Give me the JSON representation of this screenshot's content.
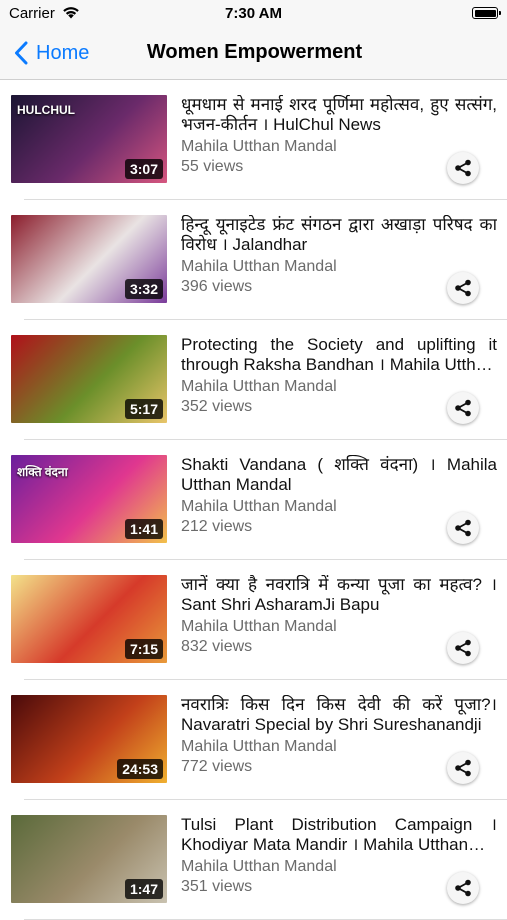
{
  "status_bar": {
    "carrier": "Carrier",
    "time": "7:30 AM"
  },
  "nav": {
    "back_label": "Home",
    "title": "Women Empowerment"
  },
  "videos": [
    {
      "title": "धूमधाम से मनाई शरद पूर्णिमा महोत्सव, हुए सत्संग, भजन-कीर्तन । HulChul News",
      "channel": "Mahila Utthan Mandal",
      "views": "55 views",
      "duration": "3:07",
      "thumb_overlay": "HULCHUL",
      "thumb_colors": [
        "#1b1533",
        "#6a2a6a",
        "#d6567f"
      ]
    },
    {
      "title": "हिन्दू यूनाइटेड फ्रंट संगठन द्वारा अखाड़ा परिषद का विरोध । Jalandhar",
      "channel": "Mahila Utthan Mandal",
      "views": "396 views",
      "duration": "3:32",
      "thumb_overlay": "",
      "thumb_colors": [
        "#8b1d2c",
        "#e9e3e3",
        "#7a3b9a"
      ]
    },
    {
      "title": "Protecting the Society and uplifting it through Raksha Bandhan । Mahila Utthan Mandal",
      "channel": "Mahila Utthan Mandal",
      "views": "352 views",
      "duration": "5:17",
      "thumb_overlay": "",
      "thumb_colors": [
        "#b0101a",
        "#6b8f2a",
        "#e9c56a"
      ]
    },
    {
      "title": "Shakti Vandana ( शक्ति वंदना) । Mahila Utthan Mandal",
      "channel": "Mahila Utthan Mandal",
      "views": "212 views",
      "duration": "1:41",
      "thumb_overlay": "शक्ति वंदना",
      "thumb_colors": [
        "#6a1f9c",
        "#e0378f",
        "#f2c14a"
      ]
    },
    {
      "title": "जानें क्या है नवरात्रि में कन्या पूजा का महत्व? । Sant Shri AsharamJi Bapu",
      "channel": "Mahila Utthan Mandal",
      "views": "832 views",
      "duration": "7:15",
      "thumb_overlay": "",
      "thumb_colors": [
        "#f3e28a",
        "#d63a2a",
        "#e89a3a"
      ]
    },
    {
      "title": "नवरात्रिः किस दिन किस देवी की करें पूजा?। Navaratri Special by Shri Sureshanandji",
      "channel": "Mahila Utthan Mandal",
      "views": "772 views",
      "duration": "24:53",
      "thumb_overlay": "",
      "thumb_colors": [
        "#4a0a0a",
        "#c2401a",
        "#f0b030"
      ]
    },
    {
      "title": "Tulsi Plant Distribution Campaign । Khodiyar Mata Mandir । Mahila Utthan Mandal",
      "channel": "Mahila Utthan Mandal",
      "views": "351 views",
      "duration": "1:47",
      "thumb_overlay": "",
      "thumb_colors": [
        "#5a6a3a",
        "#9a8a6a",
        "#c9c2b0"
      ]
    }
  ],
  "colors": {
    "accent": "#0b7bff",
    "secondary_text": "#6b6b6b"
  },
  "icons": {
    "back": "chevron-left-icon",
    "share": "share-icon",
    "wifi": "wifi-icon",
    "battery": "battery-icon"
  }
}
